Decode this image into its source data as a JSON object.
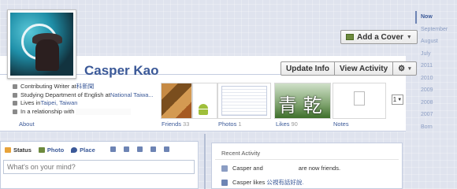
{
  "profile": {
    "name": "Casper Kao",
    "avatar_label": "Casper"
  },
  "cover": {
    "add_cover_label": "Add a Cover"
  },
  "actions": {
    "update_info": "Update Info",
    "view_activity": "View Activity",
    "gear_caret": "▾"
  },
  "about": {
    "rows": [
      {
        "icon": "briefcase-icon",
        "text": "Contributing Writer at ",
        "link": "科新聞"
      },
      {
        "icon": "graduation-cap-icon",
        "text": "Studying Department of English at ",
        "link": "National Taiwa..."
      },
      {
        "icon": "home-icon",
        "text": "Lives in ",
        "link": "Taipei, Taiwan"
      },
      {
        "icon": "heart-icon",
        "text": "In a relationship with",
        "link": ""
      }
    ],
    "about_link": "About"
  },
  "sections": {
    "friends": {
      "label": "Friends",
      "count": "33"
    },
    "photos": {
      "label": "Photos",
      "count": "1"
    },
    "likes": {
      "label": "Likes",
      "count": "90"
    },
    "notes": {
      "label": "Notes"
    },
    "more_select": "1"
  },
  "likes_thumb_text": "青 乾",
  "timeline": {
    "items": [
      "Now",
      "September",
      "August",
      "July",
      "2011",
      "2010",
      "2009",
      "2008",
      "2007",
      "Born"
    ],
    "active": "Now"
  },
  "composer": {
    "tabs": [
      "Status",
      "Photo",
      "Place"
    ],
    "placeholder": "What's on your mind?"
  },
  "activity": {
    "title": "Recent Activity",
    "rows": [
      {
        "prefix": "Casper and",
        "suffix": "are now friends.",
        "link": ""
      },
      {
        "prefix": "Casper likes",
        "suffix": "",
        "link": "公視有話好說."
      }
    ]
  },
  "colors": {
    "brand": "#3b5998",
    "timeline_bg": "#dfe3ee"
  }
}
